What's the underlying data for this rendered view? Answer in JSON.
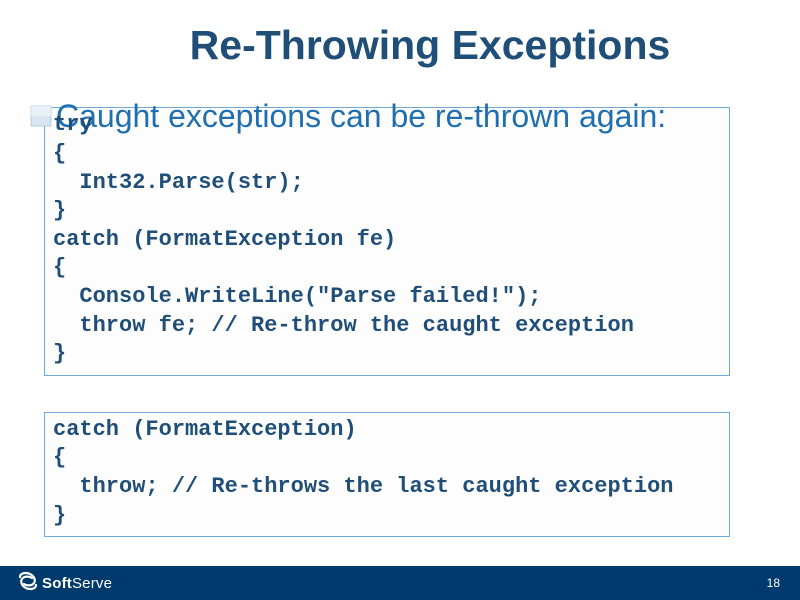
{
  "title": "Re-Throwing Exceptions",
  "bullet": "Caught exceptions can be re-thrown again:",
  "codeBlock1": "try\n{\n  Int32.Parse(str);\n}\ncatch (FormatException fe)\n{\n  Console.WriteLine(\"Parse failed!\");\n  throw fe; // Re-throw the caught exception\n}",
  "codeBlock2": "catch (FormatException)\n{\n  throw; // Re-throws the last caught exception\n}",
  "brandPrefix": "Soft",
  "brandSuffix": "Serve",
  "pageNumber": "18",
  "colors": {
    "titleColor": "#1f4e79",
    "bulletColor": "#1f6fb0",
    "codeBorder": "#6fa8dc",
    "footerBg": "#003a6c"
  }
}
